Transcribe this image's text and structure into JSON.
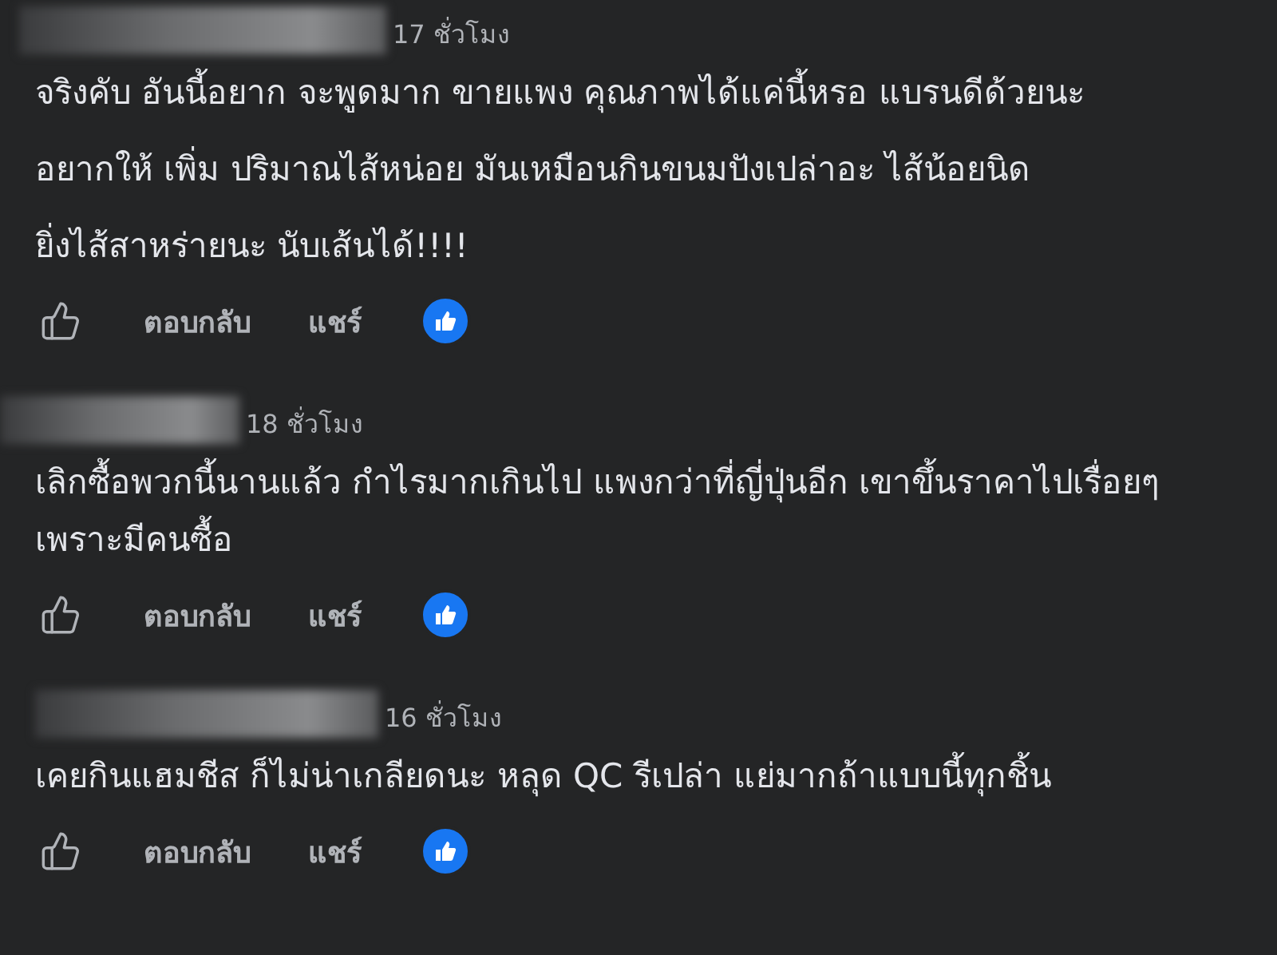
{
  "comments": [
    {
      "time": "17 ชั่วโมง",
      "paragraphs": [
        "จริงคับ อันนี้อยาก จะพูดมาก ขายแพง คุณภาพได้แค่นี้หรอ แบรนดีด้วยนะ",
        "อยากให้ เพิ่ม ปริมาณไส้หน่อย มันเหมือนกินขนมปังเปล่าอะ ไส้น้อยนิด",
        "ยิ่งไส้สาหร่ายนะ นับเส้นได้!!!!"
      ],
      "actions": [
        "ตอบกลับ",
        "แชร์"
      ]
    },
    {
      "time": "18 ชั่วโมง",
      "paragraphs": [
        "เลิกซื้อพวกนี้นานแล้ว กำไรมากเกินไป แพงกว่าที่ญี่ปุ่นอีก เขาขึ้นราคาไปเรื่อยๆเพราะมีคนซื้อ"
      ],
      "actions": [
        "ตอบกลับ",
        "แชร์"
      ]
    },
    {
      "time": "16 ชั่วโมง",
      "paragraphs": [
        "เคยกินแฮมชีส ก็ไม่น่าเกลียดนะ หลุด QC รีเปล่า แย่มากถ้าแบบนี้ทุกชิ้น"
      ],
      "actions": [
        "ตอบกลับ",
        "แชร์"
      ]
    }
  ]
}
